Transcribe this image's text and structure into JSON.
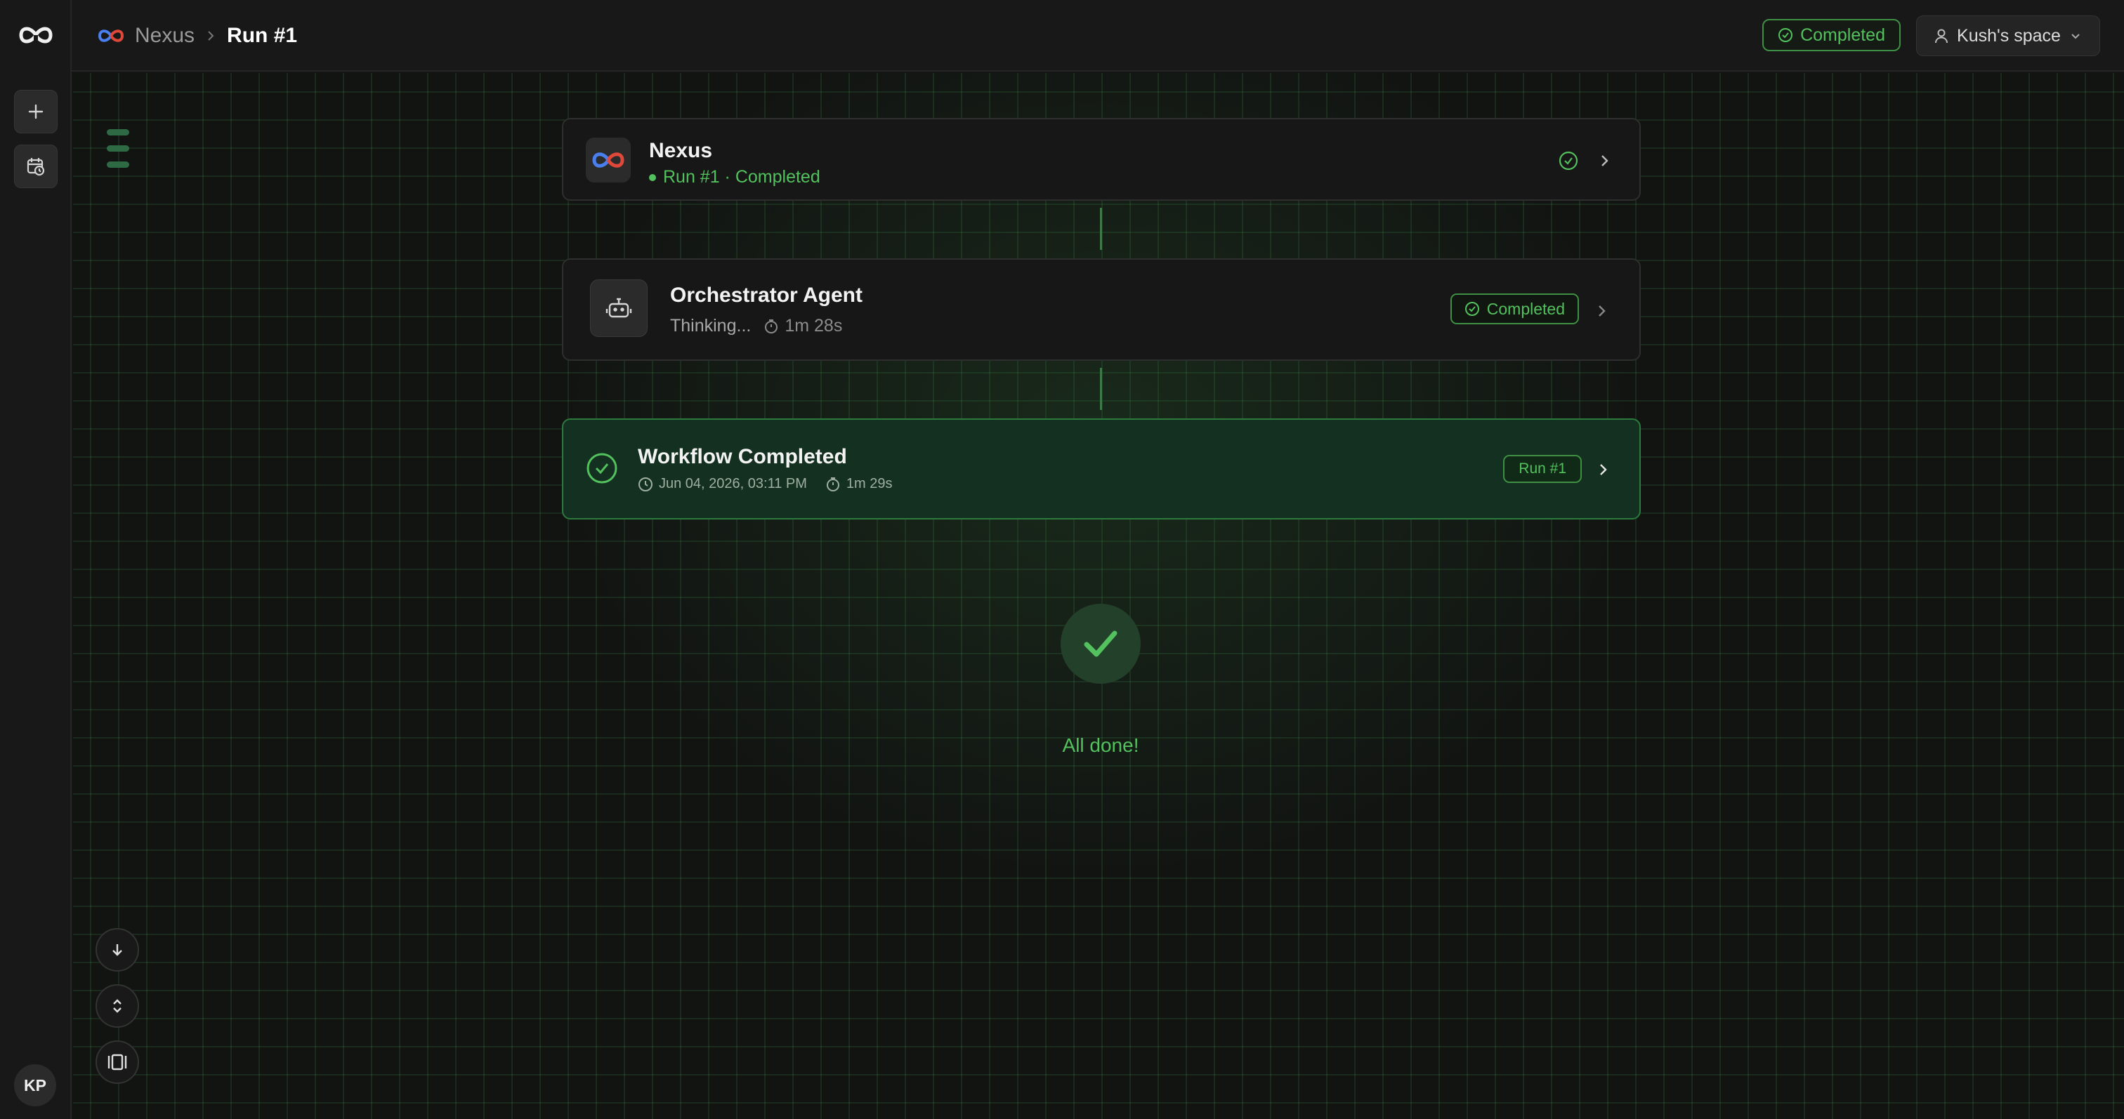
{
  "app": {
    "logo_icon": "infinity-logo-icon",
    "user_initials": "KP"
  },
  "sidebar": {
    "items": [
      {
        "icon": "plus-icon"
      },
      {
        "icon": "calendar-clock-icon"
      }
    ]
  },
  "header": {
    "breadcrumb_root": "Nexus",
    "breadcrumb_current": "Run #1",
    "status": "Completed",
    "space": "Kush's space"
  },
  "flow": {
    "trigger": {
      "title": "Nexus",
      "subtitle": "Run #1 · Completed"
    },
    "agent": {
      "title": "Orchestrator Agent",
      "status_text": "Thinking...",
      "duration": "1m 28s",
      "badge": "Completed"
    },
    "result": {
      "title": "Workflow Completed",
      "timestamp": "Jun 04, 2026, 03:11 PM",
      "duration": "1m 29s",
      "badge": "Run #1"
    },
    "final_message": "All done!"
  },
  "colors": {
    "accent_green": "#53c15d",
    "background": "#141514",
    "completed_card_bg": "#143020"
  }
}
